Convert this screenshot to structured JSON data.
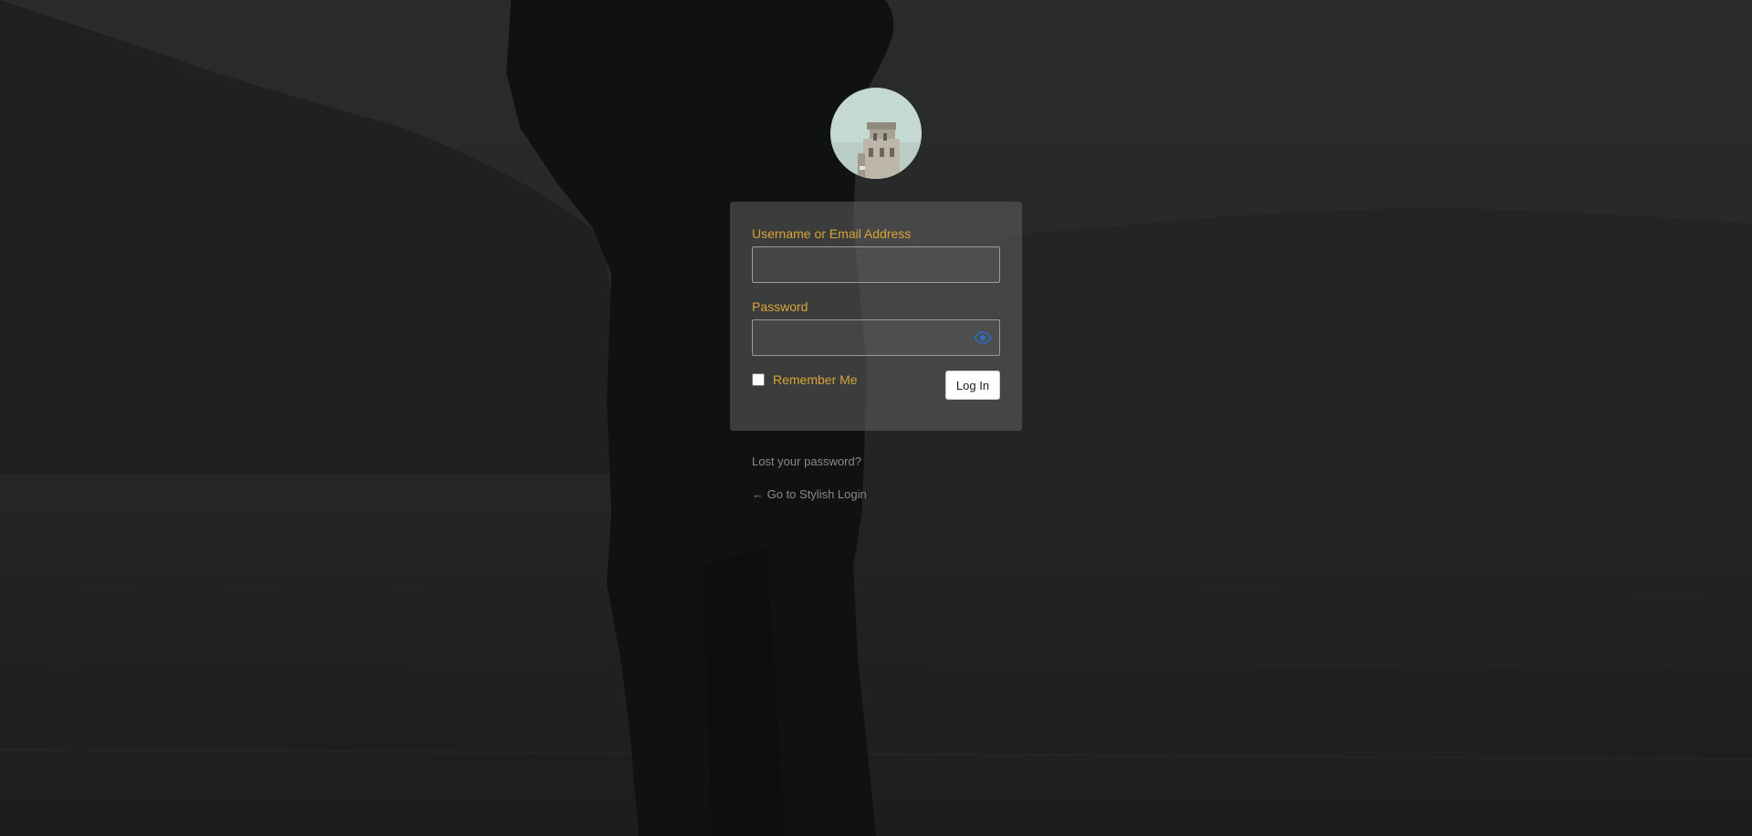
{
  "form": {
    "username_label": "Username or Email Address",
    "username_value": "",
    "password_label": "Password",
    "password_value": "",
    "remember_label": "Remember Me",
    "remember_checked": false,
    "login_button": "Log In"
  },
  "links": {
    "lost_password": "Lost your password?",
    "back_to_site": "← Go to Stylish Login"
  },
  "icons": {
    "show_password": "eye-icon"
  },
  "colors": {
    "label_accent": "#d9a436",
    "eye_icon": "#2b6cc4",
    "panel": "rgba(100,100,100,0.52)"
  }
}
